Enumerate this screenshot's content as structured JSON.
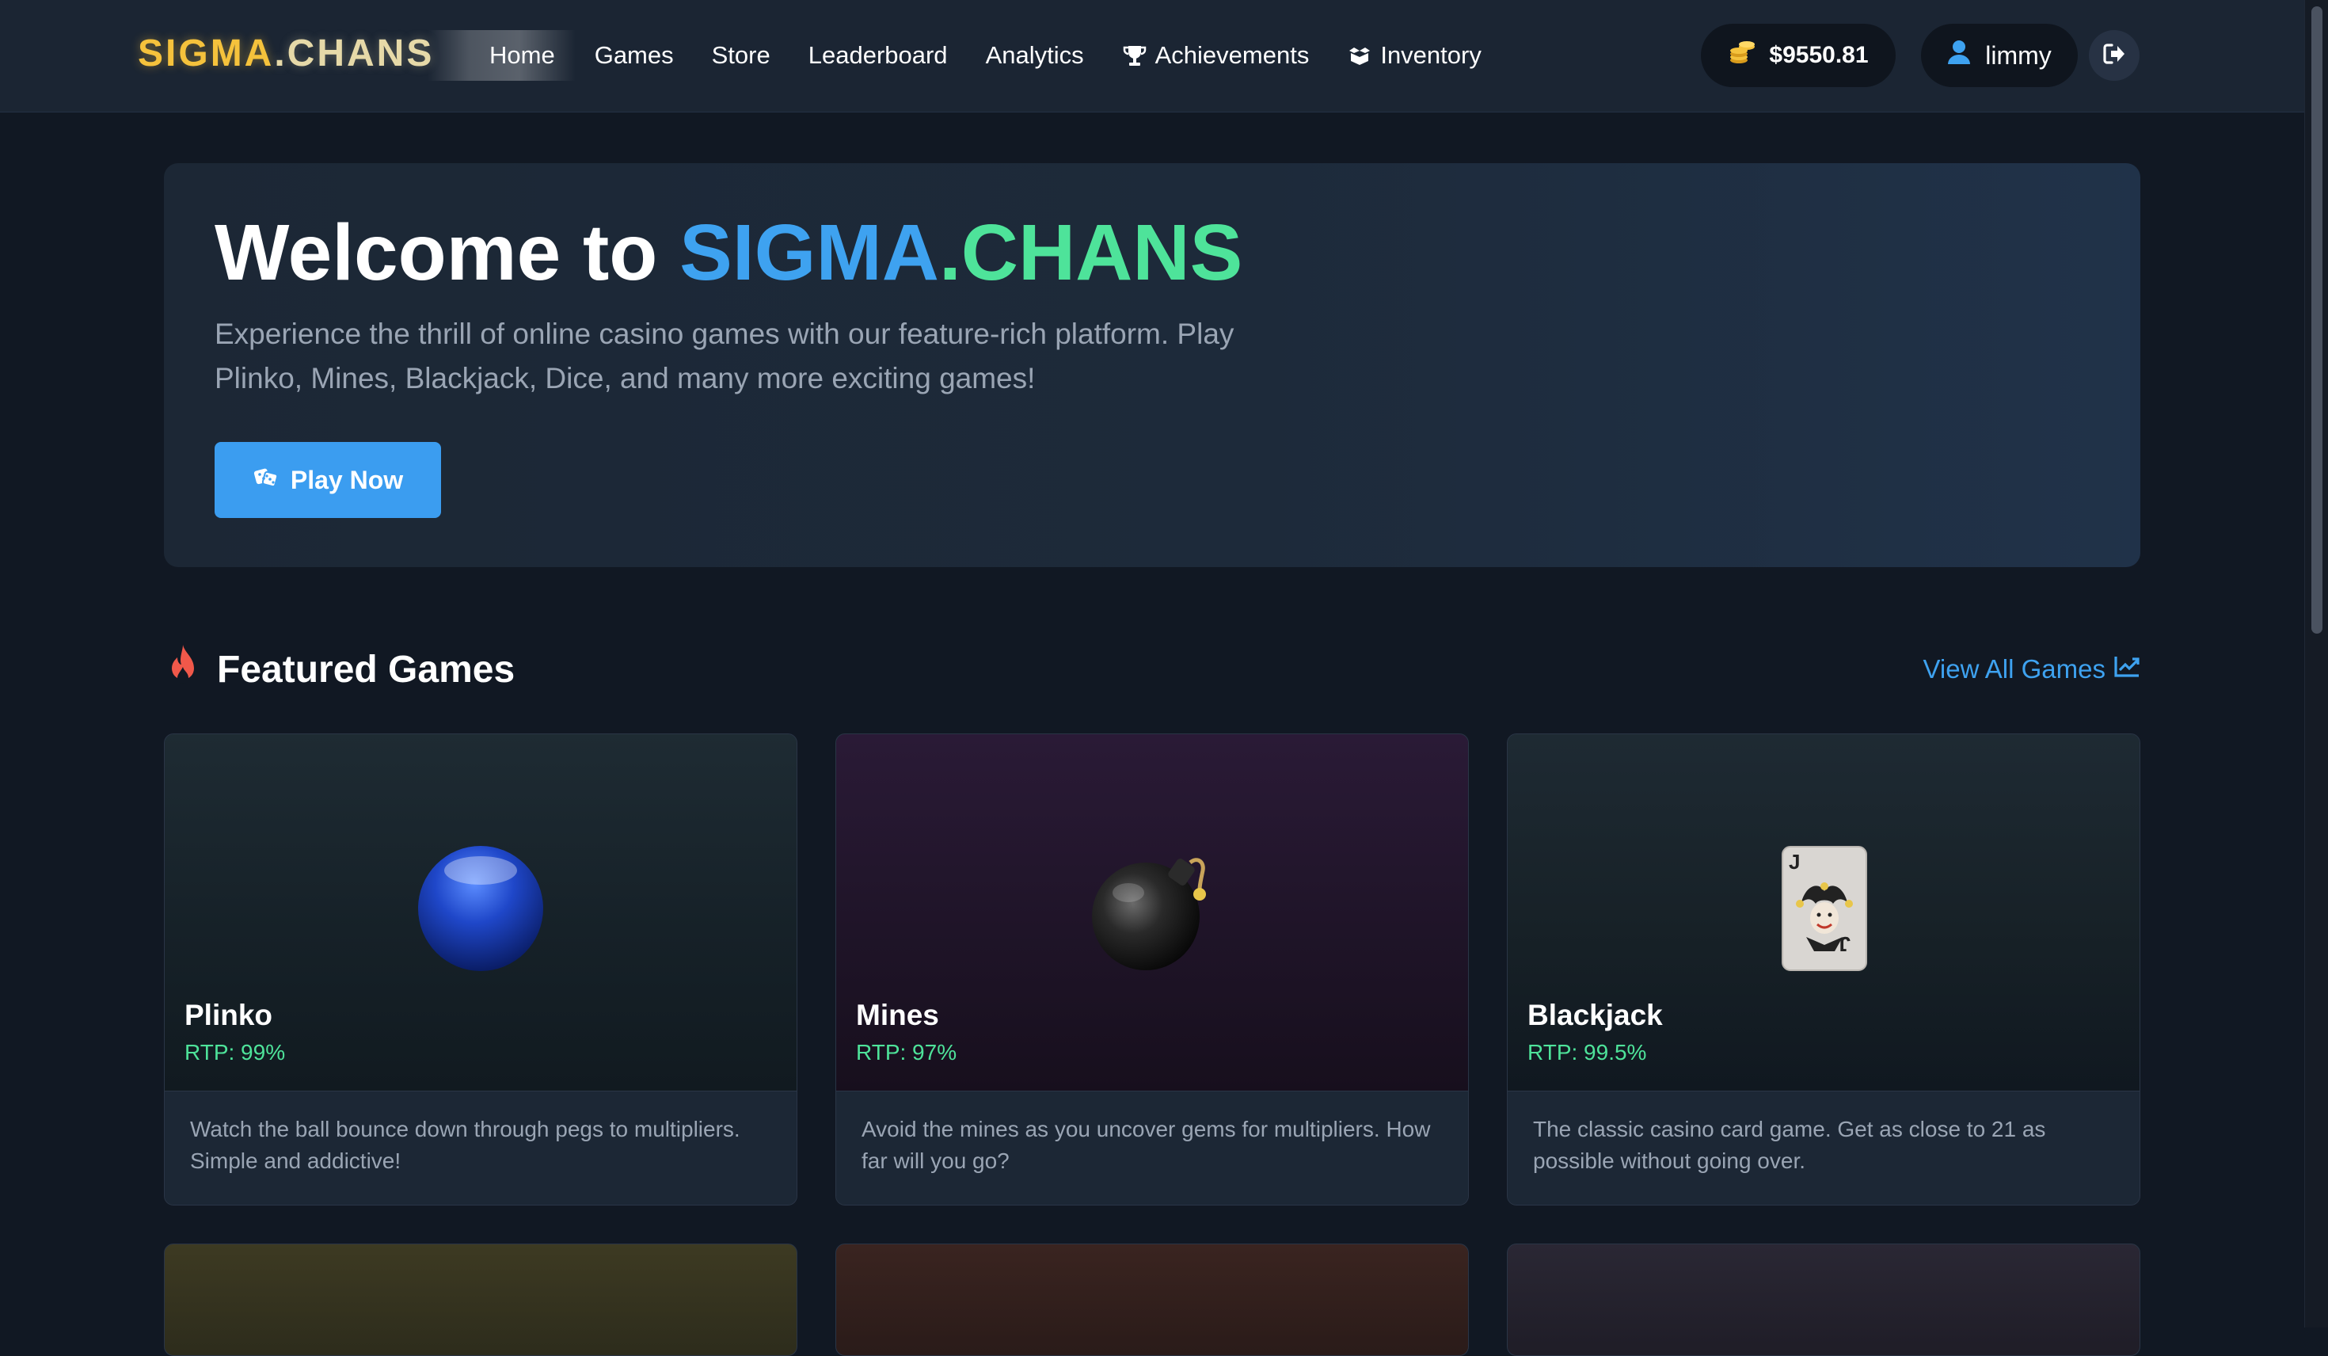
{
  "nav": {
    "logo_part1": "SIGMA",
    "logo_part2": ".CHANS",
    "links": [
      {
        "label": "Home",
        "active": true
      },
      {
        "label": "Games"
      },
      {
        "label": "Store"
      },
      {
        "label": "Leaderboard"
      },
      {
        "label": "Analytics"
      },
      {
        "label": "Achievements",
        "icon": "trophy-icon"
      },
      {
        "label": "Inventory",
        "icon": "box-icon"
      }
    ],
    "balance": "$9550.81",
    "balance_icon": "coins-icon",
    "username": "limmy",
    "user_icon": "user-icon",
    "logout_icon": "logout-icon"
  },
  "hero": {
    "title_prefix": "Welcome to ",
    "title_brand_a": "SIGMA",
    "title_brand_b": ".CHANS",
    "description": "Experience the thrill of online casino games with our feature-rich platform. Play Plinko, Mines, Blackjack, Dice, and many more exciting games!",
    "button_label": "Play Now",
    "button_icon": "dice-icon"
  },
  "featured": {
    "title": "Featured Games",
    "title_icon": "fire-icon",
    "view_all_label": "View All Games",
    "view_all_icon": "chart-line-icon",
    "games": [
      {
        "name": "Plinko",
        "rtp": "RTP: 99%",
        "description": "Watch the ball bounce down through pegs to multipliers. Simple and addictive!",
        "icon": "blue-ball-icon"
      },
      {
        "name": "Mines",
        "rtp": "RTP: 97%",
        "description": "Avoid the mines as you uncover gems for multipliers. How far will you go?",
        "icon": "bomb-icon"
      },
      {
        "name": "Blackjack",
        "rtp": "RTP: 99.5%",
        "description": "The classic casino card game. Get as close to 21 as possible without going over.",
        "icon": "joker-card-icon"
      }
    ]
  },
  "colors": {
    "accent_blue": "#3ea2f0",
    "accent_green": "#4ee39a",
    "gold": "#f5c23c",
    "background": "#111823"
  }
}
